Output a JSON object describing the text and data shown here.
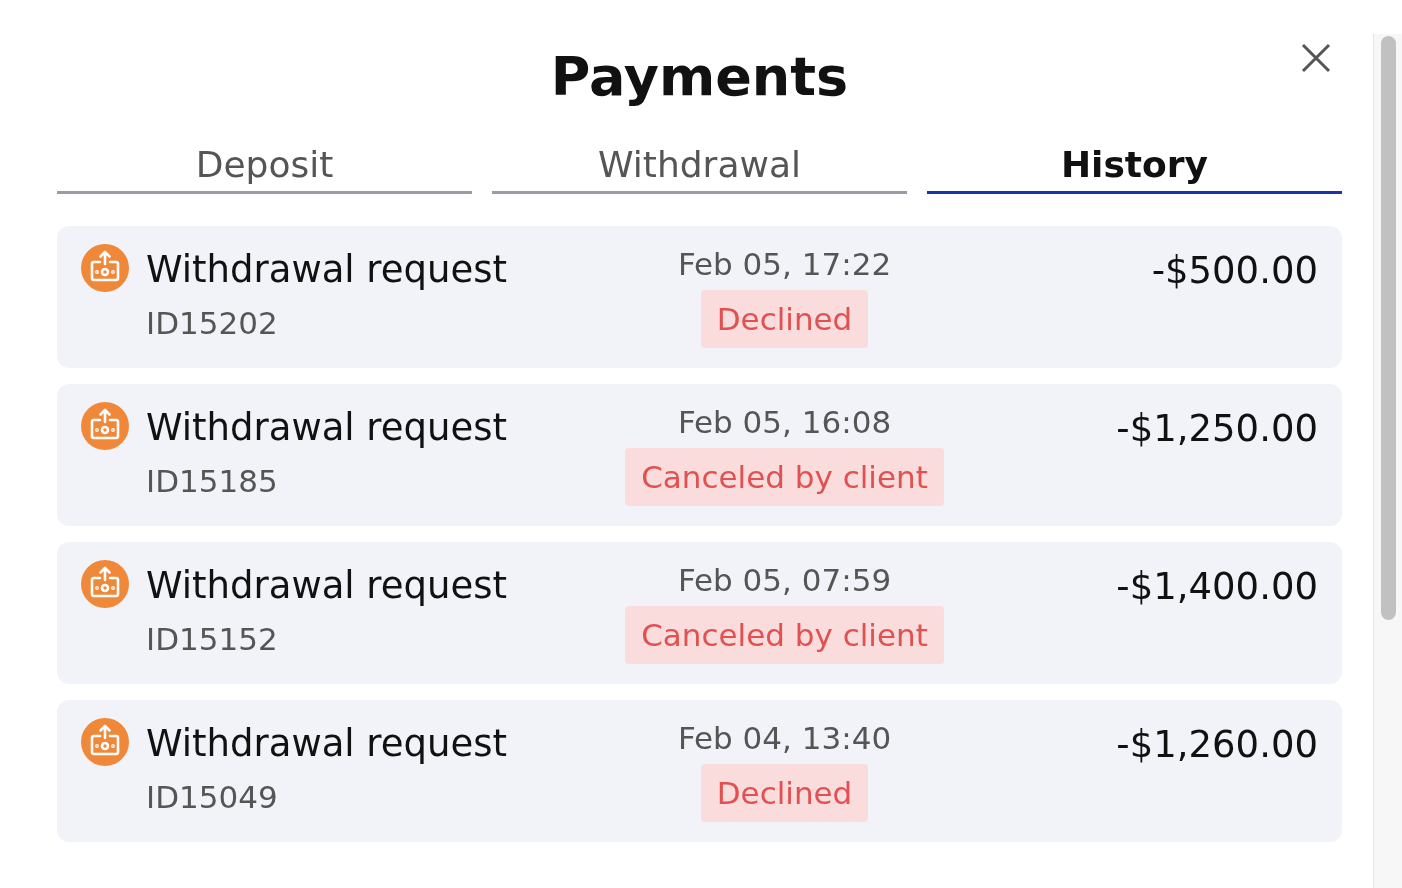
{
  "title": "Payments",
  "tabs": [
    {
      "label": "Deposit",
      "selected": false
    },
    {
      "label": "Withdrawal",
      "selected": false
    },
    {
      "label": "History",
      "selected": true
    }
  ],
  "transactions": [
    {
      "title": "Withdrawal request",
      "id": "ID15202",
      "date": "Feb 05, 17:22",
      "status": "Declined",
      "amount": "-$500.00"
    },
    {
      "title": "Withdrawal request",
      "id": "ID15185",
      "date": "Feb 05, 16:08",
      "status": "Canceled by client",
      "amount": "-$1,250.00"
    },
    {
      "title": "Withdrawal request",
      "id": "ID15152",
      "date": "Feb 05, 07:59",
      "status": "Canceled by client",
      "amount": "-$1,400.00"
    },
    {
      "title": "Withdrawal request",
      "id": "ID15049",
      "date": "Feb 04, 13:40",
      "status": "Declined",
      "amount": "-$1,260.00"
    }
  ]
}
